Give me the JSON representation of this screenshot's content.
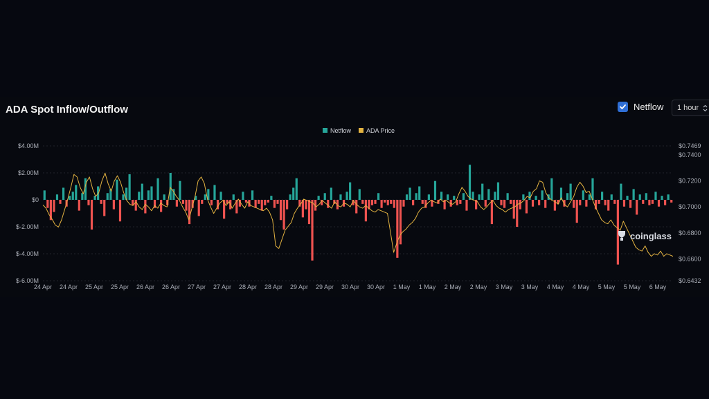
{
  "header": {
    "title": "ADA Spot Inflow/Outflow",
    "netflow_toggle_label": "Netflow",
    "netflow_checked": true,
    "interval_value": "1 hour"
  },
  "watermark": "coinglass",
  "colors": {
    "inflow": "#26a69a",
    "outflow": "#ef5350",
    "price": "#e3b341",
    "checkbox": "#2f6fd6"
  },
  "chart_data": {
    "type": "bar",
    "legend": [
      "Netflow",
      "ADA Price"
    ],
    "legend_position": "top-center",
    "grid": true,
    "left_axis": {
      "ticks": [
        "$4.00M",
        "$2.00M",
        "$0",
        "$-2.00M",
        "$-4.00M",
        "$-6.00M"
      ],
      "range": [
        -6000000,
        4000000
      ]
    },
    "right_axis": {
      "ticks": [
        "$0.7469",
        "$0.7400",
        "$0.7200",
        "$0.7000",
        "$0.6800",
        "$0.6600",
        "$0.6432"
      ],
      "range": [
        0.6432,
        0.7469
      ]
    },
    "x_labels": [
      "24 Apr",
      "24 Apr",
      "25 Apr",
      "25 Apr",
      "26 Apr",
      "26 Apr",
      "27 Apr",
      "27 Apr",
      "28 Apr",
      "28 Apr",
      "29 Apr",
      "29 Apr",
      "30 Apr",
      "30 Apr",
      "1 May",
      "1 May",
      "2 May",
      "2 May",
      "3 May",
      "3 May",
      "4 May",
      "4 May",
      "5 May",
      "5 May",
      "6 May"
    ],
    "series": [
      {
        "name": "Netflow",
        "unit": "USD",
        "values": [
          0.7,
          -0.6,
          -1.5,
          -0.9,
          0.4,
          -0.3,
          0.9,
          -0.5,
          0.3,
          0.6,
          1.1,
          -0.8,
          0.5,
          1.6,
          -0.4,
          -2.2,
          0.3,
          1.0,
          -0.3,
          -1.2,
          0.5,
          0.8,
          -0.7,
          1.5,
          -1.6,
          0.4,
          0.9,
          1.9,
          -0.4,
          -0.8,
          0.6,
          1.2,
          -1.0,
          0.7,
          1.0,
          -0.6,
          1.6,
          -0.9,
          0.4,
          -0.4,
          2.0,
          0.8,
          -0.5,
          1.4,
          -0.3,
          -0.8,
          -1.8,
          -0.6,
          0.3,
          -1.2,
          -0.3,
          0.4,
          0.8,
          -0.4,
          1.1,
          -0.7,
          0.6,
          -1.4,
          -0.3,
          -0.7,
          0.4,
          -1.0,
          -0.5,
          0.6,
          -0.2,
          -0.5,
          0.7,
          -0.6,
          -0.3,
          -0.8,
          -0.4,
          -0.2,
          0.3,
          -0.6,
          -0.3,
          -1.5,
          -2.2,
          -0.7,
          0.4,
          0.9,
          1.6,
          -0.5,
          -1.3,
          -0.7,
          -1.8,
          -4.5,
          -0.8,
          0.3,
          -0.4,
          0.5,
          -0.6,
          0.9,
          -0.3,
          -0.7,
          0.4,
          -0.5,
          0.6,
          1.3,
          -0.4,
          -1.0,
          0.8,
          -0.3,
          -1.6,
          -0.7,
          -0.4,
          -0.3,
          0.5,
          -0.6,
          -0.2,
          -0.4,
          -0.3,
          -0.6,
          -4.3,
          -3.3,
          -0.5,
          0.4,
          0.9,
          -0.4,
          0.5,
          1.0,
          -0.3,
          -0.6,
          0.4,
          -0.5,
          1.4,
          -0.3,
          0.6,
          -0.7,
          0.4,
          -0.5,
          0.3,
          -0.4,
          -0.3,
          0.5,
          -0.8,
          2.6,
          0.6,
          -0.7,
          0.4,
          1.2,
          -0.5,
          0.8,
          -1.8,
          0.6,
          1.3,
          -0.4,
          -0.6,
          0.5,
          -0.3,
          -1.4,
          -2.0,
          -0.7,
          0.4,
          -1.0,
          0.6,
          -0.5,
          0.3,
          -0.4,
          0.7,
          -0.6,
          0.4,
          1.6,
          -0.8,
          -0.3,
          0.9,
          -0.5,
          0.5,
          1.2,
          -0.6,
          -1.7,
          -0.4,
          0.7,
          -0.5,
          0.4,
          1.6,
          -0.7,
          -0.3,
          0.6,
          -0.4,
          -0.8,
          0.4,
          -0.3,
          -4.8,
          1.2,
          -0.5,
          0.3,
          -0.6,
          0.8,
          -1.1,
          0.4,
          -0.3,
          0.5,
          -0.4,
          -0.3,
          0.6,
          -0.5,
          0.3,
          -0.4,
          0.4,
          -0.2
        ],
        "scale": 1000000
      },
      {
        "name": "ADA Price",
        "unit": "USD",
        "values": [
          0.7015,
          0.699,
          0.694,
          0.6905,
          0.686,
          0.6845,
          0.69,
          0.698,
          0.706,
          0.715,
          0.725,
          0.723,
          0.715,
          0.71,
          0.719,
          0.723,
          0.714,
          0.708,
          0.711,
          0.72,
          0.726,
          0.718,
          0.712,
          0.72,
          0.724,
          0.719,
          0.711,
          0.705,
          0.702,
          0.701,
          0.704,
          0.7,
          0.698,
          0.702,
          0.7,
          0.697,
          0.701,
          0.699,
          0.703,
          0.701,
          0.7,
          0.715,
          0.712,
          0.708,
          0.705,
          0.7,
          0.696,
          0.69,
          0.699,
          0.708,
          0.72,
          0.723,
          0.718,
          0.706,
          0.7,
          0.695,
          0.699,
          0.703,
          0.705,
          0.701,
          0.704,
          0.699,
          0.703,
          0.706,
          0.702,
          0.699,
          0.704,
          0.701,
          0.7,
          0.699,
          0.698,
          0.697,
          0.699,
          0.696,
          0.69,
          0.67,
          0.668,
          0.675,
          0.682,
          0.685,
          0.688,
          0.695,
          0.699,
          0.702,
          0.706,
          0.705,
          0.704,
          0.703,
          0.7,
          0.702,
          0.705,
          0.703,
          0.701,
          0.699,
          0.704,
          0.701,
          0.7,
          0.703,
          0.702,
          0.7,
          0.705,
          0.702,
          0.7,
          0.699,
          0.701,
          0.699,
          0.697,
          0.696,
          0.698,
          0.697,
          0.696,
          0.695,
          0.68,
          0.665,
          0.672,
          0.678,
          0.681,
          0.683,
          0.686,
          0.688,
          0.691,
          0.696,
          0.699,
          0.7,
          0.703,
          0.705,
          0.704,
          0.703,
          0.706,
          0.704,
          0.705,
          0.703,
          0.702,
          0.704,
          0.71,
          0.715,
          0.712,
          0.708,
          0.706,
          0.705,
          0.704,
          0.7,
          0.698,
          0.7,
          0.703,
          0.705,
          0.701,
          0.699,
          0.698,
          0.696,
          0.698,
          0.699,
          0.7,
          0.702,
          0.703,
          0.705,
          0.708,
          0.707,
          0.712,
          0.714,
          0.72,
          0.719,
          0.711,
          0.707,
          0.705,
          0.704,
          0.702,
          0.707,
          0.702,
          0.7,
          0.704,
          0.708,
          0.715,
          0.719,
          0.716,
          0.711,
          0.712,
          0.706,
          0.7,
          0.695,
          0.69,
          0.688,
          0.687,
          0.69,
          0.686,
          0.684,
          0.682,
          0.689,
          0.684,
          0.679,
          0.674,
          0.669,
          0.667,
          0.666,
          0.67,
          0.665,
          0.662,
          0.664,
          0.663,
          0.666,
          0.662,
          0.664,
          0.663,
          0.662
        ]
      }
    ]
  }
}
